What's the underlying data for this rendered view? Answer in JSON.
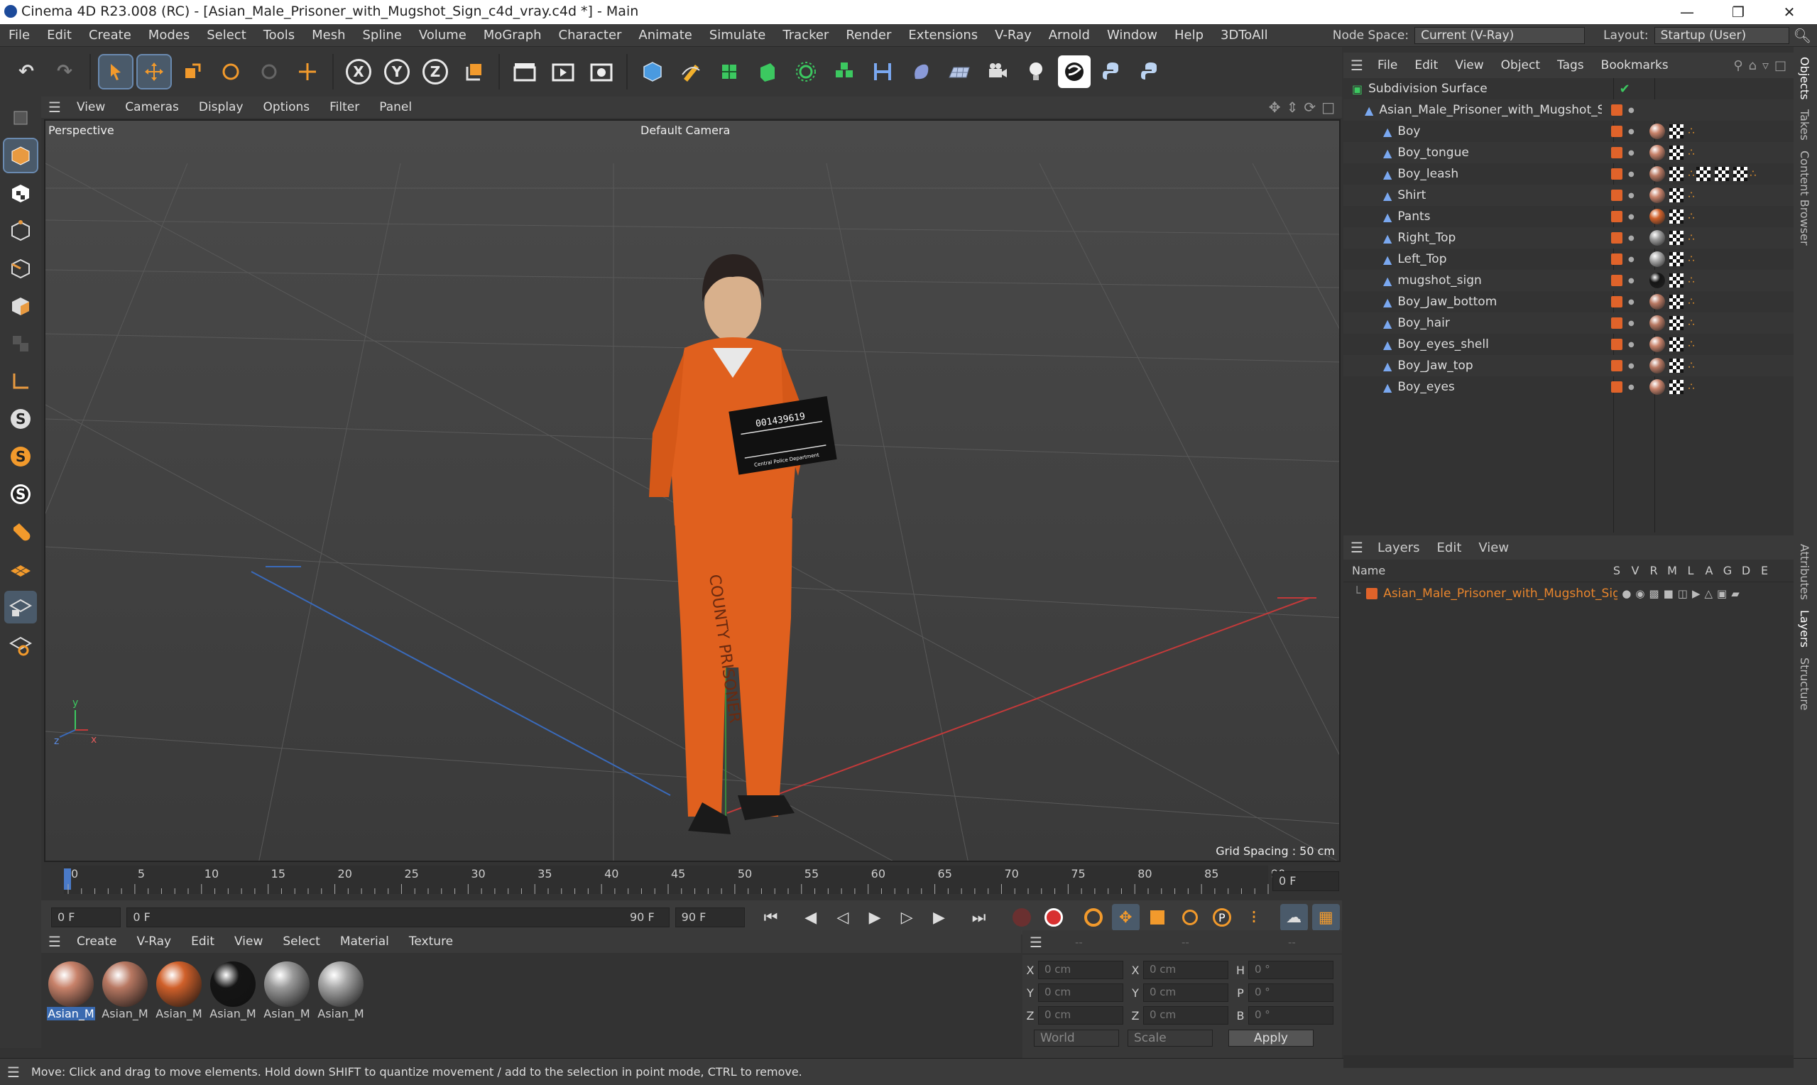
{
  "window": {
    "title": "Cinema 4D R23.008 (RC) - [Asian_Male_Prisoner_with_Mugshot_Sign_c4d_vray.c4d *] - Main",
    "minimize": "—",
    "maximize": "❐",
    "close": "✕"
  },
  "menubar": {
    "items": [
      "File",
      "Edit",
      "Create",
      "Modes",
      "Select",
      "Tools",
      "Mesh",
      "Spline",
      "Volume",
      "MoGraph",
      "Character",
      "Animate",
      "Simulate",
      "Tracker",
      "Render",
      "Extensions",
      "V-Ray",
      "Arnold",
      "Window",
      "Help",
      "3DToAll"
    ],
    "node_space_label": "Node Space:",
    "node_space_value": "Current (V-Ray)",
    "layout_label": "Layout:",
    "layout_value": "Startup (User)"
  },
  "toolbar": {
    "undo": "↶",
    "redo": "↷",
    "axis_x": "X",
    "axis_y": "Y",
    "axis_z": "Z"
  },
  "viewport": {
    "menu": [
      "View",
      "Cameras",
      "Display",
      "Options",
      "Filter",
      "Panel"
    ],
    "label": "Perspective",
    "camera": "Default Camera",
    "grid_spacing": "Grid Spacing : 50 cm",
    "sign_number": "001439619",
    "sign_dept": "Central Police Department",
    "pants_text": "COUNTY PRISONER"
  },
  "timeline": {
    "ticks": [
      "0",
      "5",
      "10",
      "15",
      "20",
      "25",
      "30",
      "35",
      "40",
      "45",
      "50",
      "55",
      "60",
      "65",
      "70",
      "75",
      "80",
      "85",
      "90"
    ],
    "end_field": "0 F"
  },
  "transport": {
    "start": "0 F",
    "current": "0 F",
    "range_end": "90 F",
    "end": "90 F"
  },
  "materials": {
    "menu": [
      "Create",
      "V-Ray",
      "Edit",
      "View",
      "Select",
      "Material",
      "Texture"
    ],
    "items": [
      {
        "label": "Asian_M",
        "color": "#c8826a"
      },
      {
        "label": "Asian_M",
        "color": "#b87862"
      },
      {
        "label": "Asian_M",
        "color": "#d0602a"
      },
      {
        "label": "Asian_M",
        "color": "#151515"
      },
      {
        "label": "Asian_M",
        "color": "#9a9a9a"
      },
      {
        "label": "Asian_M",
        "color": "#a8a8a8"
      }
    ]
  },
  "coords": {
    "rows": [
      {
        "a": "X",
        "av": "0 cm",
        "b": "X",
        "bv": "0 cm",
        "c": "H",
        "cv": "0 °"
      },
      {
        "a": "Y",
        "av": "0 cm",
        "b": "Y",
        "bv": "0 cm",
        "c": "P",
        "cv": "0 °"
      },
      {
        "a": "Z",
        "av": "0 cm",
        "b": "Z",
        "bv": "0 cm",
        "c": "B",
        "cv": "0 °"
      }
    ],
    "space": "World",
    "mode": "Scale",
    "apply": "Apply",
    "dash1": "--",
    "dash2": "--",
    "dash3": "--"
  },
  "objects": {
    "menu": [
      "File",
      "Edit",
      "View",
      "Object",
      "Tags",
      "Bookmarks"
    ],
    "root": "Subdivision Surface",
    "group": "Asian_Male_Prisoner_with_Mugshot_Sign",
    "items": [
      "Boy",
      "Boy_tongue",
      "Boy_leash",
      "Shirt",
      "Pants",
      "Right_Top",
      "Left_Top",
      "mugshot_sign",
      "Boy_Jaw_bottom",
      "Boy_hair",
      "Boy_eyes_shell",
      "Boy_Jaw_top",
      "Boy_eyes"
    ]
  },
  "layers": {
    "menu": [
      "Layers",
      "Edit",
      "View"
    ],
    "name_header": "Name",
    "cols": [
      "S",
      "V",
      "R",
      "M",
      "L",
      "A",
      "G",
      "D",
      "E"
    ],
    "layer_name": "Asian_Male_Prisoner_with_Mugshot_Sign"
  },
  "right_tabs": [
    "Objects",
    "Takes",
    "Content Browser",
    "Attributes",
    "Layers",
    "Structure"
  ],
  "status": "Move: Click and drag to move elements. Hold down SHIFT to quantize movement / add to the selection in point mode, CTRL to remove."
}
